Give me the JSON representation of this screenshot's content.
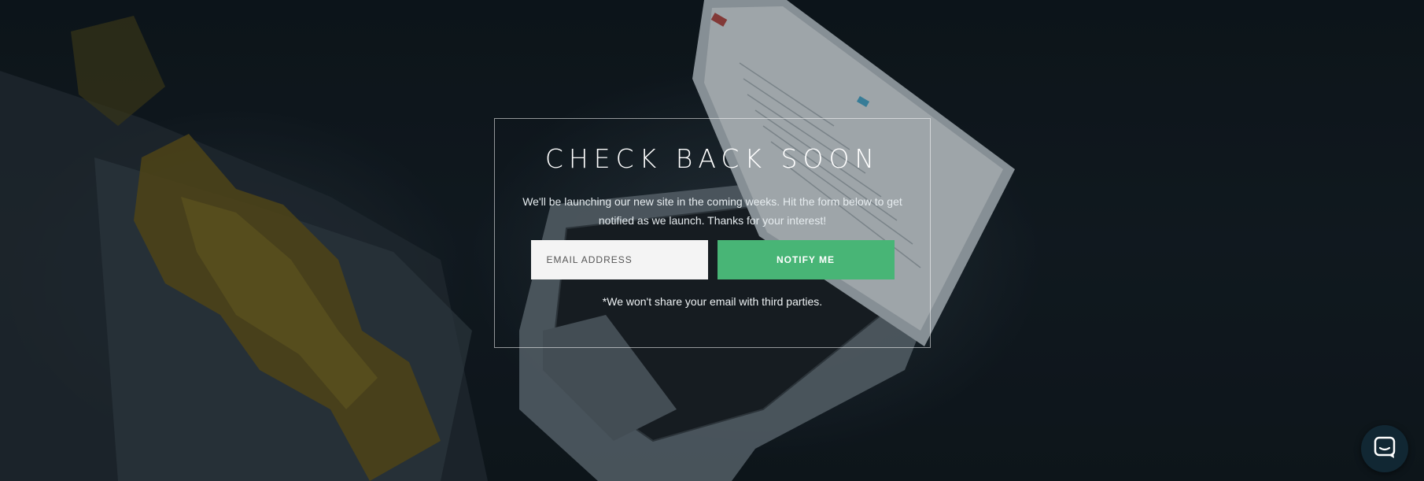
{
  "hero": {
    "title": "CHECK BACK SOON",
    "subtitle": "We'll be launching our new site in the coming weeks. Hit the form below to get notified as we launch. Thanks for your interest!",
    "disclaimer": "*We won't share your email with third parties."
  },
  "form": {
    "email_placeholder": "EMAIL ADDRESS",
    "email_value": "",
    "submit_label": "NOTIFY ME"
  },
  "chat": {
    "icon": "chat-bubble-icon"
  },
  "colors": {
    "accent": "#48b576",
    "background": "#0d1419",
    "chat_button": "#112733"
  }
}
